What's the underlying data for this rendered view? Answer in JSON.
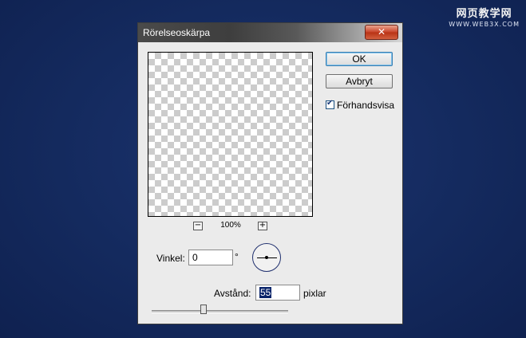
{
  "watermark": {
    "top": "网页教学网",
    "bottom": "WWW.WEB3X.COM"
  },
  "dialog": {
    "title": "Rörelseoskärpa",
    "close_glyph": "✕",
    "ok_label": "OK",
    "cancel_label": "Avbryt",
    "preview_label": "Förhandsvisa",
    "preview_checked": true,
    "zoom": {
      "minus": "−",
      "plus": "+",
      "level": "100%"
    },
    "angle": {
      "label": "Vinkel:",
      "value": "0",
      "unit": "°"
    },
    "distance": {
      "label": "Avstånd:",
      "value": "55",
      "unit": "pixlar",
      "slider_fraction": 0.38
    }
  }
}
